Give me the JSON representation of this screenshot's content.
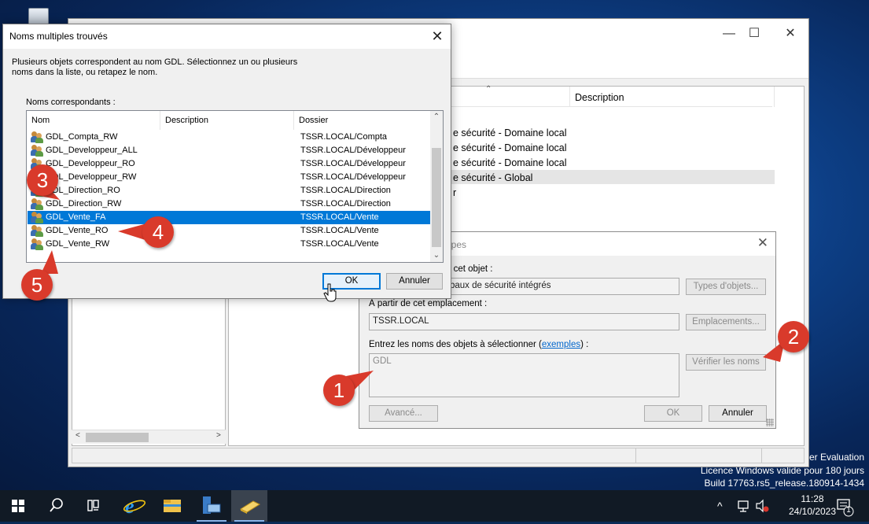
{
  "watermark": {
    "line1": "ter Evaluation",
    "line2": "Licence Windows valide pour 180 jours",
    "line3": "Build 17763.rs5_release.180914-1434"
  },
  "aduc": {
    "window_controls": {
      "minimize": "—",
      "maximize": "☐",
      "close": "✕"
    },
    "description_header": "Description",
    "type_lines": [
      "e sécurité - Domaine local",
      "e sécurité - Domaine local",
      "e sécurité - Domaine local",
      "e sécurité - Global",
      "r"
    ],
    "scroll_left": "<",
    "scroll_right": ">"
  },
  "select_dialog": {
    "title": "upes",
    "close_label": "✕",
    "object_type_label": "e cet objet :",
    "object_type_value": "baux de sécurité intégrés",
    "object_types_button": "Types d'objets...",
    "location_label": "À partir de cet emplacement :",
    "location_value": "TSSR.LOCAL",
    "locations_button": "Emplacements...",
    "enter_names_prefix": "Entrez les noms des objets à sélectionner (",
    "enter_names_link": "exemples",
    "enter_names_suffix": ") :",
    "names_value": "GDL",
    "check_names_button": "Vérifier les noms",
    "advanced_button": "Avancé...",
    "ok_button": "OK",
    "cancel_button": "Annuler"
  },
  "multiple_names_dialog": {
    "title": "Noms multiples trouvés",
    "close_label": "✕",
    "intro_line1": "Plusieurs objets correspondent au nom GDL. Sélectionnez un ou plusieurs",
    "intro_line2": "noms dans la liste, ou retapez le nom.",
    "list_label": "Noms correspondants :",
    "columns": {
      "name": "Nom",
      "description": "Description",
      "folder": "Dossier"
    },
    "rows": [
      {
        "name": "GDL_Compta_RW",
        "folder": "TSSR.LOCAL/Compta",
        "selected": false
      },
      {
        "name": "GDL_Developpeur_ALL",
        "folder": "TSSR.LOCAL/Développeur",
        "selected": false
      },
      {
        "name": "GDL_Developpeur_RO",
        "folder": "TSSR.LOCAL/Développeur",
        "selected": false
      },
      {
        "name": "GDL_Developpeur_RW",
        "folder": "TSSR.LOCAL/Développeur",
        "selected": false
      },
      {
        "name": "GDL_Direction_RO",
        "folder": "TSSR.LOCAL/Direction",
        "selected": false
      },
      {
        "name": "GDL_Direction_RW",
        "folder": "TSSR.LOCAL/Direction",
        "selected": false
      },
      {
        "name": "GDL_Vente_FA",
        "folder": "TSSR.LOCAL/Vente",
        "selected": true
      },
      {
        "name": "GDL_Vente_RO",
        "folder": "TSSR.LOCAL/Vente",
        "selected": false
      },
      {
        "name": "GDL_Vente_RW",
        "folder": "TSSR.LOCAL/Vente",
        "selected": false
      }
    ],
    "scroll_up": "⌃",
    "scroll_down": "⌄",
    "ok_button": "OK",
    "cancel_button": "Annuler"
  },
  "annotations": [
    "1",
    "2",
    "3",
    "4",
    "5"
  ],
  "taskbar": {
    "pinned_icons": [
      "windows-start-icon",
      "search-icon",
      "task-view-icon",
      "internet-explorer-icon",
      "file-explorer-icon",
      "server-manager-icon",
      "ad-users-computers-icon"
    ],
    "tray_chevron": "^",
    "time": "11:28",
    "date": "24/10/2023",
    "notification_count": "1"
  },
  "colors": {
    "selection": "#0078d7",
    "badge": "#d93a2b",
    "taskbar": "#111a25"
  }
}
